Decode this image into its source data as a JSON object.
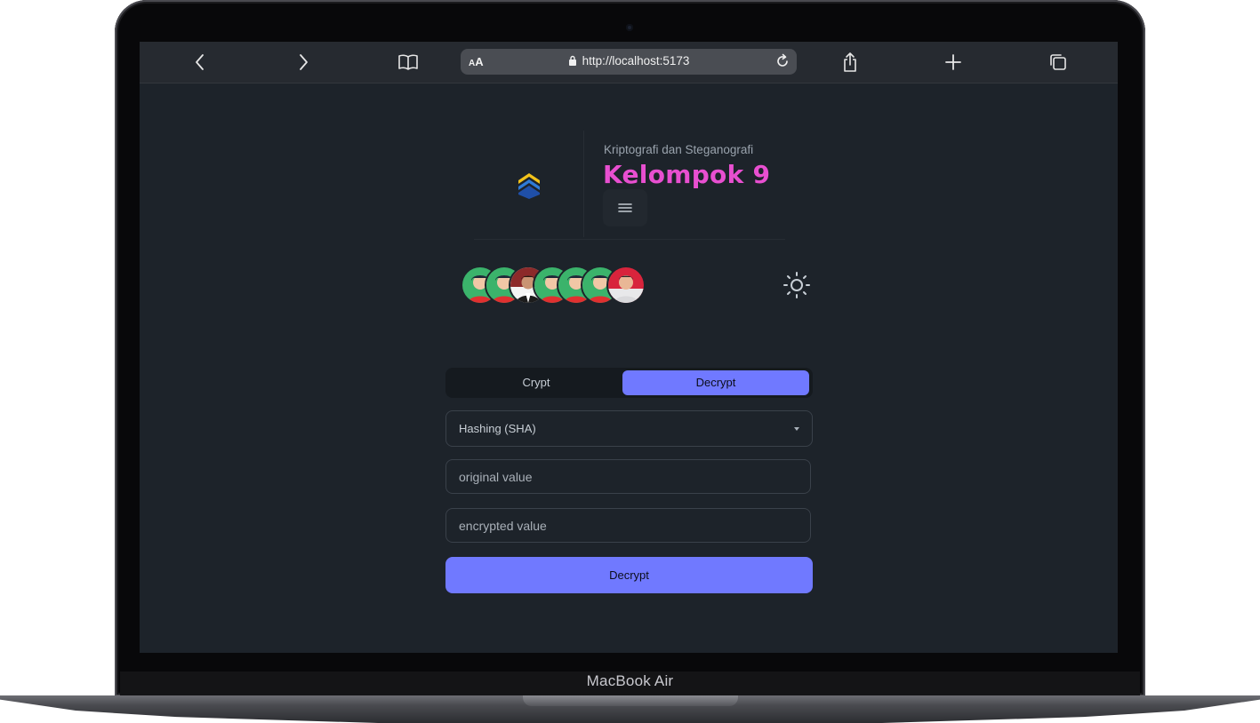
{
  "device": {
    "brand_label": "MacBook Air"
  },
  "browser": {
    "url_prefix_label": "AA",
    "url": "http://localhost:5173",
    "icons": [
      "chevron-left-icon",
      "chevron-right-icon",
      "book-icon",
      "lock-icon",
      "reload-icon",
      "share-icon",
      "plus-icon",
      "tabs-icon"
    ]
  },
  "header": {
    "subtitle": "Kriptografi dan Steganografi",
    "title": "Kelompok 9",
    "title_color": "#e84fd0",
    "menu_icon": "hamburger-menu-icon"
  },
  "team": {
    "avatars": [
      {
        "kind": "cartoon"
      },
      {
        "kind": "cartoon"
      },
      {
        "kind": "photo"
      },
      {
        "kind": "cartoon"
      },
      {
        "kind": "cartoon"
      },
      {
        "kind": "cartoon"
      },
      {
        "kind": "photo"
      }
    ],
    "theme_icon": "sun-icon"
  },
  "tabs": [
    {
      "label": "Crypt",
      "active": false
    },
    {
      "label": "Decrypt",
      "active": true
    }
  ],
  "form": {
    "method_selected": "Hashing (SHA)",
    "original_placeholder": "original value",
    "encrypted_placeholder": "encrypted value",
    "submit_label": "Decrypt"
  },
  "colors": {
    "accent": "#7079ff",
    "background": "#1d232a",
    "toolbar": "#262a30"
  }
}
